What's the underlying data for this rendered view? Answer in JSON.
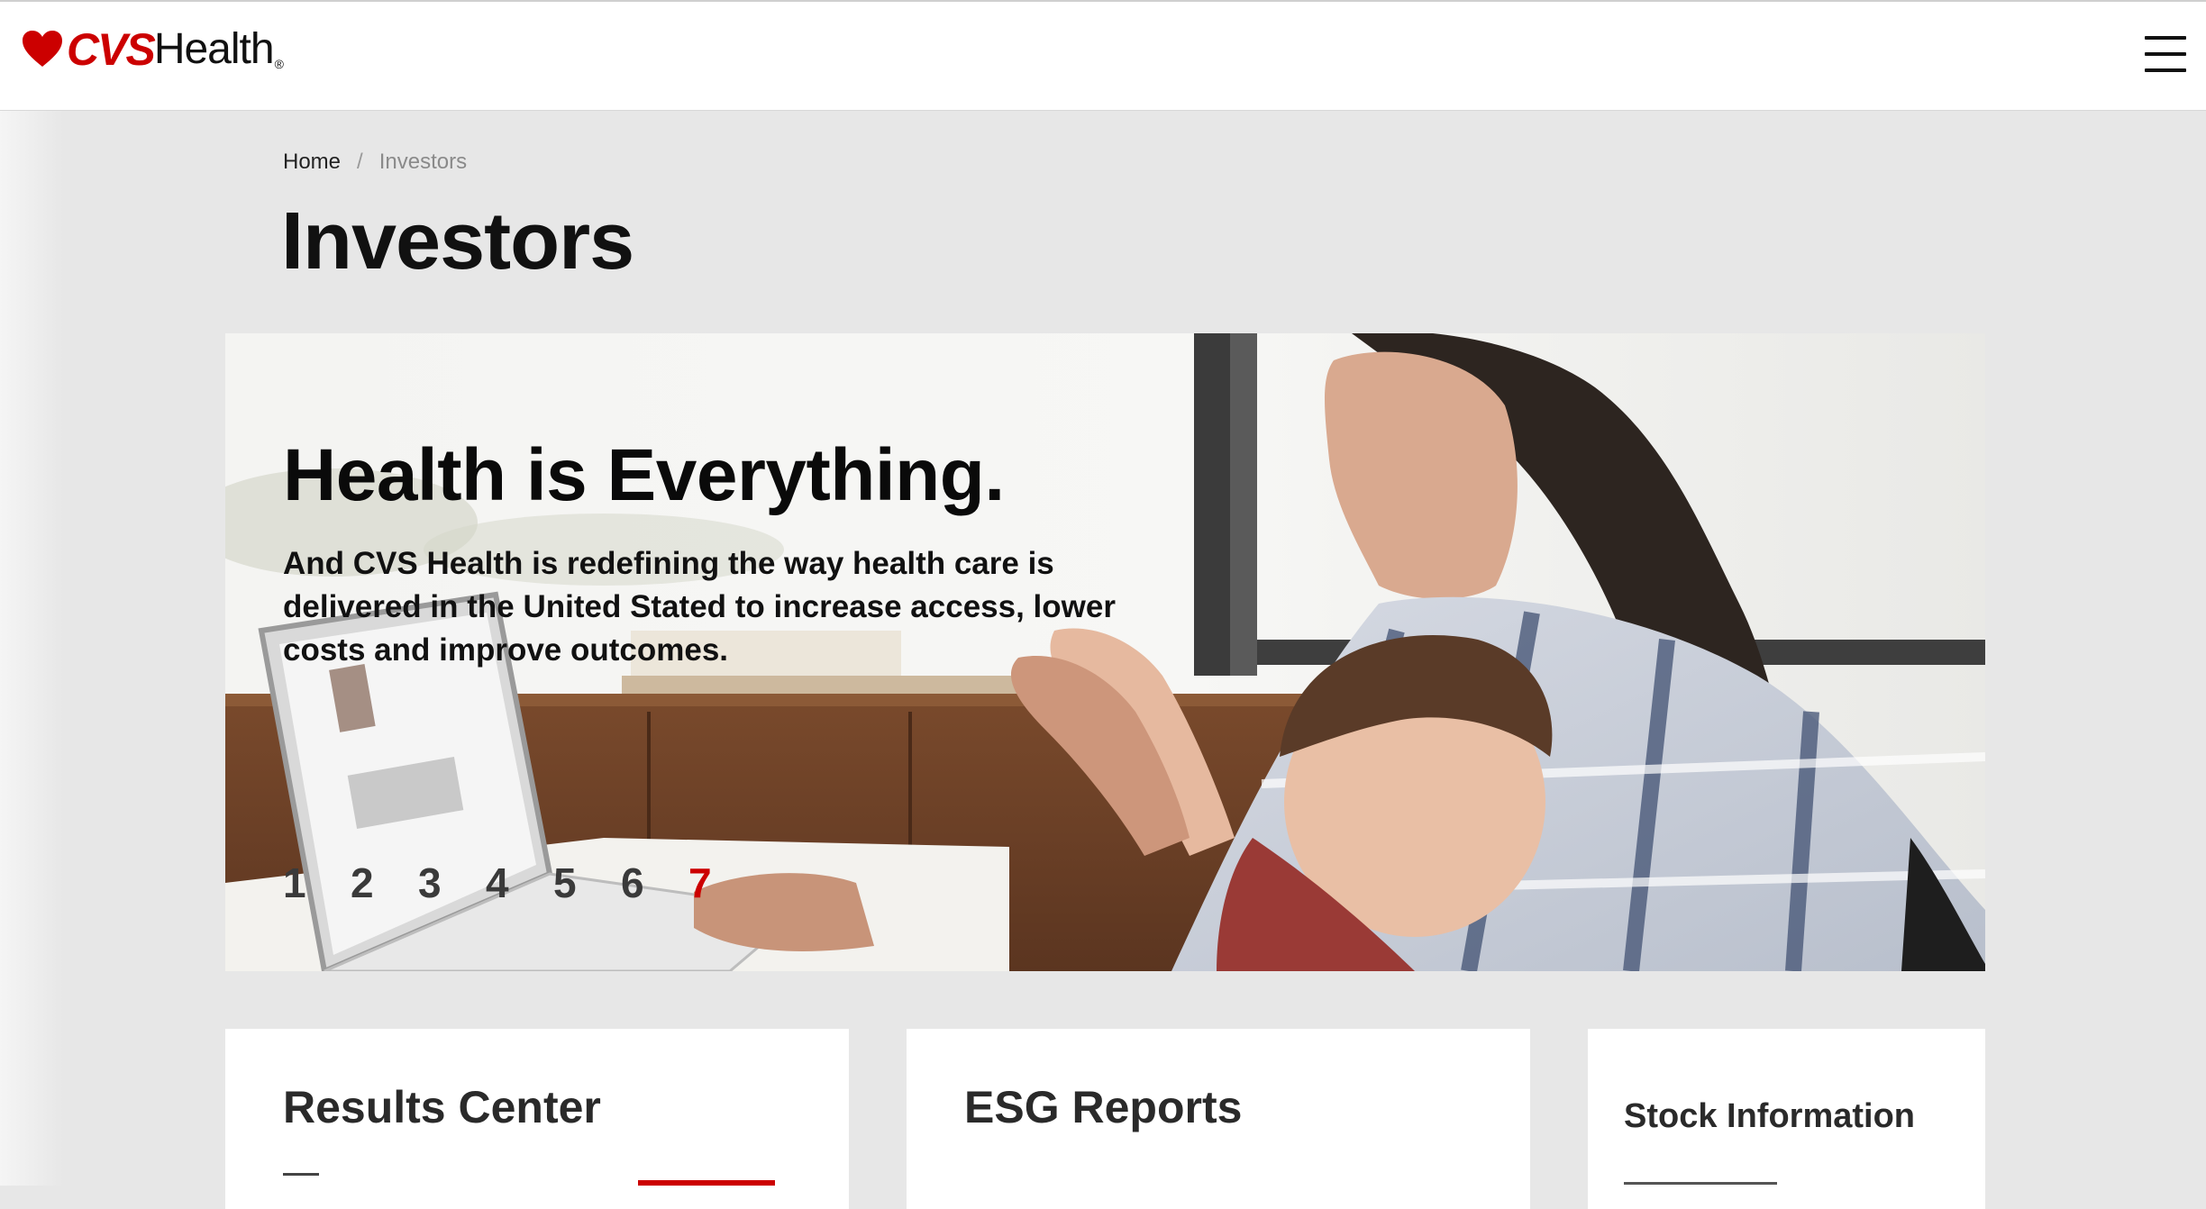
{
  "header": {
    "logo": {
      "brand_bold": "CVS",
      "brand_light": "Health",
      "registered": "®"
    },
    "menu_icon": "hamburger-menu-icon"
  },
  "breadcrumb": {
    "items": [
      "Home",
      "Investors"
    ],
    "separator": "/"
  },
  "page": {
    "title": "Investors"
  },
  "hero": {
    "headline": "Health is Everything.",
    "subtext": "And CVS Health is redefining the way health care is delivered in the United Stated to increase access, lower costs and improve outcomes.",
    "slides": [
      "1",
      "2",
      "3",
      "4",
      "5",
      "6",
      "7"
    ],
    "active_slide": 7
  },
  "cards": [
    {
      "title": "Results Center"
    },
    {
      "title": "ESG Reports"
    },
    {
      "title": "Stock Information"
    }
  ],
  "colors": {
    "brand_red": "#cc0000",
    "page_bg": "#e7e7e7",
    "header_bg": "#ffffff",
    "text_dark": "#111111"
  }
}
